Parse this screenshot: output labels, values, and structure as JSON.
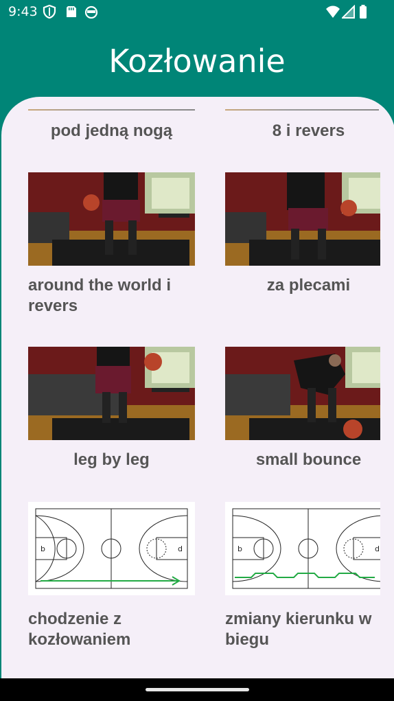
{
  "status_bar": {
    "time": "9:43",
    "left_icons": [
      "shield-icon",
      "sd-card-icon",
      "android-face-icon"
    ],
    "right_icons": [
      "wifi-icon",
      "signal-icon",
      "battery-icon"
    ]
  },
  "header": {
    "title": "Kozłowanie"
  },
  "colors": {
    "primary": "#008577",
    "surface": "#f5eff8",
    "label": "#555555",
    "court_line": "#222222",
    "path_green": "#22aa44"
  },
  "exercises": [
    {
      "label": "pod jedną nogą",
      "thumbnail": "none"
    },
    {
      "label": "8 i revers",
      "thumbnail": "none"
    },
    {
      "label": "around the world i revers",
      "thumbnail": "photo"
    },
    {
      "label": "za plecami",
      "thumbnail": "photo"
    },
    {
      "label": "leg by leg",
      "thumbnail": "photo"
    },
    {
      "label": "small bounce",
      "thumbnail": "photo"
    },
    {
      "label": "chodzenie z kozłowaniem",
      "thumbnail": "court-diagram-straight"
    },
    {
      "label": "zmiany kierunku w biegu",
      "thumbnail": "court-diagram-zigzag"
    }
  ]
}
